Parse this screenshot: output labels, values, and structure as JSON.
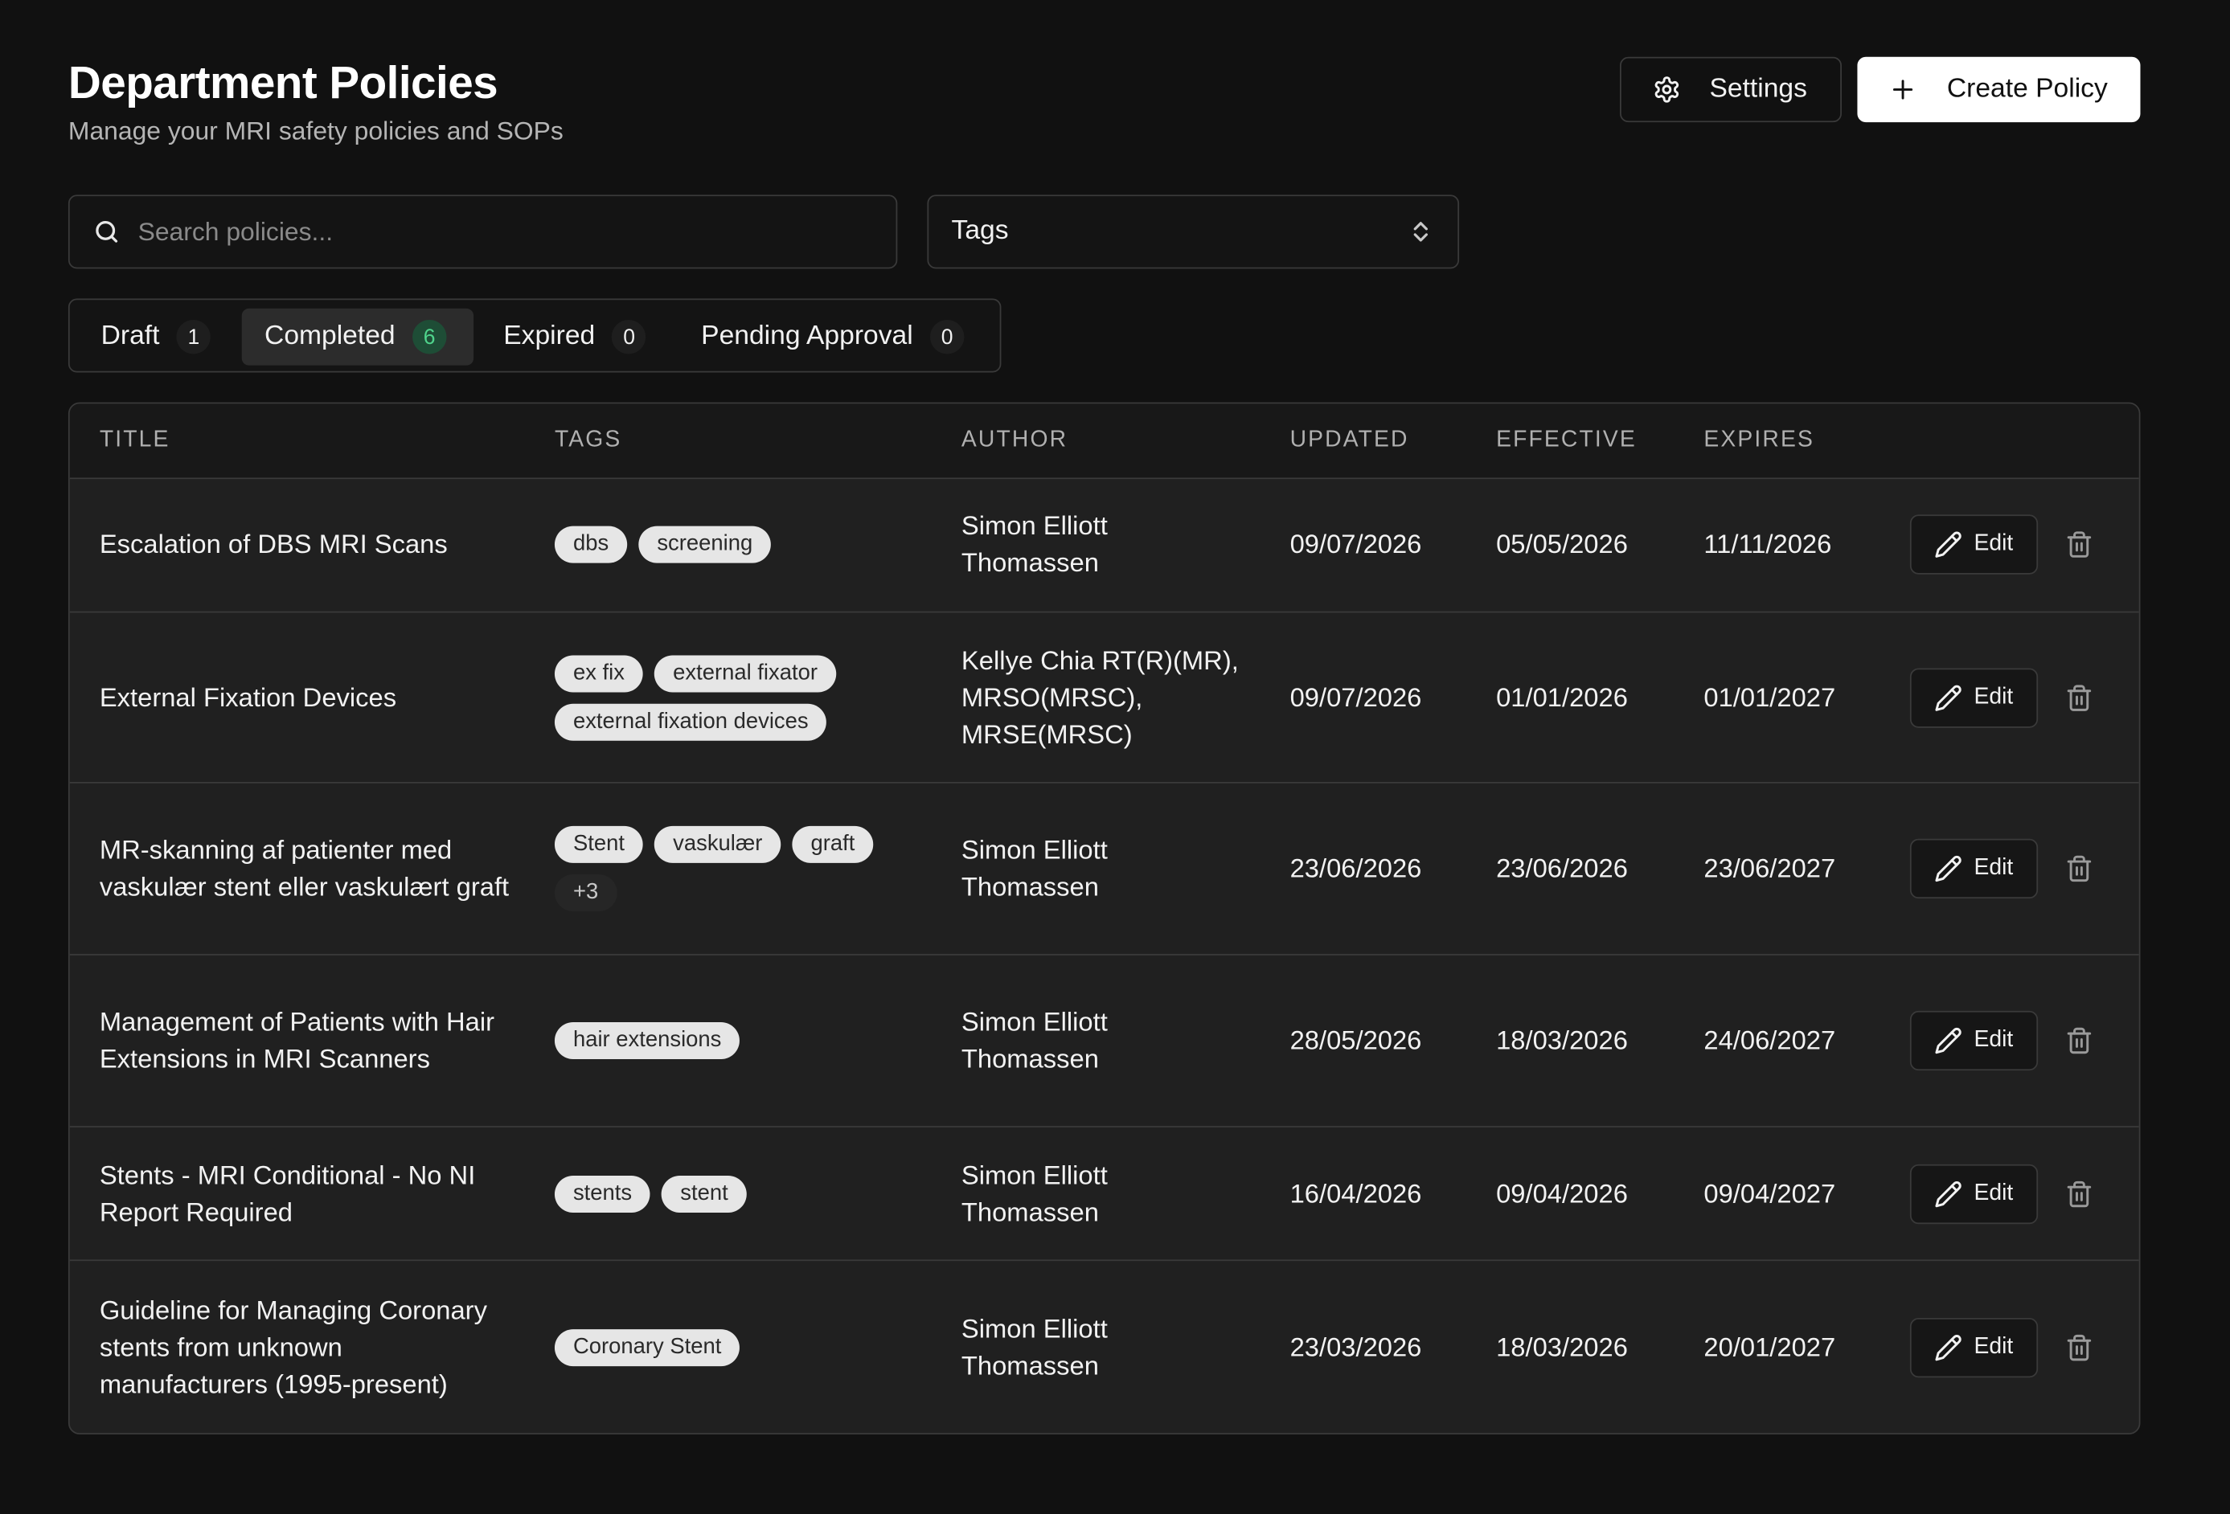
{
  "header": {
    "title": "Department Policies",
    "subtitle": "Manage your MRI safety policies and SOPs",
    "settings_label": "Settings",
    "create_label": "Create Policy"
  },
  "filters": {
    "search_placeholder": "Search policies...",
    "search_value": "",
    "tags_label": "Tags"
  },
  "tabs": [
    {
      "label": "Draft",
      "count": "1"
    },
    {
      "label": "Completed",
      "count": "6"
    },
    {
      "label": "Expired",
      "count": "0"
    },
    {
      "label": "Pending Approval",
      "count": "0"
    }
  ],
  "active_tab": "Completed",
  "colors": {
    "background": "#111111",
    "active_count_bg": "#1e4d36",
    "active_count_text": "#4fd48c"
  },
  "table": {
    "headers": {
      "title": "TITLE",
      "tags": "TAGS",
      "author": "AUTHOR",
      "updated": "UPDATED",
      "effective": "EFFECTIVE",
      "expires": "EXPIRES"
    },
    "edit_label": "Edit",
    "rows": [
      {
        "title": "Escalation of DBS MRI Scans",
        "tags": [
          "dbs",
          "screening"
        ],
        "author": "Simon Elliott Thomassen",
        "updated": "09/07/2026",
        "effective": "05/05/2026",
        "expires": "11/11/2026"
      },
      {
        "title": "External Fixation Devices",
        "tags": [
          "ex fix",
          "external fixator",
          "external fixation devices"
        ],
        "author": "Kellye Chia RT(R)(MR), MRSO(MRSC), MRSE(MRSC)",
        "updated": "09/07/2026",
        "effective": "01/01/2026",
        "expires": "01/01/2027"
      },
      {
        "title": "MR-skanning af patienter med vaskulær stent eller vaskulært graft",
        "tags": [
          "Stent",
          "vaskulær",
          "graft"
        ],
        "more_tags": "+3",
        "author": "Simon Elliott Thomassen",
        "updated": "23/06/2026",
        "effective": "23/06/2026",
        "expires": "23/06/2027"
      },
      {
        "title": "Management of Patients with Hair Extensions in MRI Scanners",
        "tags": [
          "hair extensions"
        ],
        "author": "Simon Elliott Thomassen",
        "updated": "28/05/2026",
        "effective": "18/03/2026",
        "expires": "24/06/2027"
      },
      {
        "title": "Stents - MRI Conditional - No NI Report Required",
        "tags": [
          "stents",
          "stent"
        ],
        "author": "Simon Elliott Thomassen",
        "updated": "16/04/2026",
        "effective": "09/04/2026",
        "expires": "09/04/2027"
      },
      {
        "title": "Guideline for Managing Coronary stents from unknown manufacturers (1995-present)",
        "tags": [
          "Coronary Stent"
        ],
        "author": "Simon Elliott Thomassen",
        "updated": "23/03/2026",
        "effective": "18/03/2026",
        "expires": "20/01/2027"
      }
    ]
  }
}
